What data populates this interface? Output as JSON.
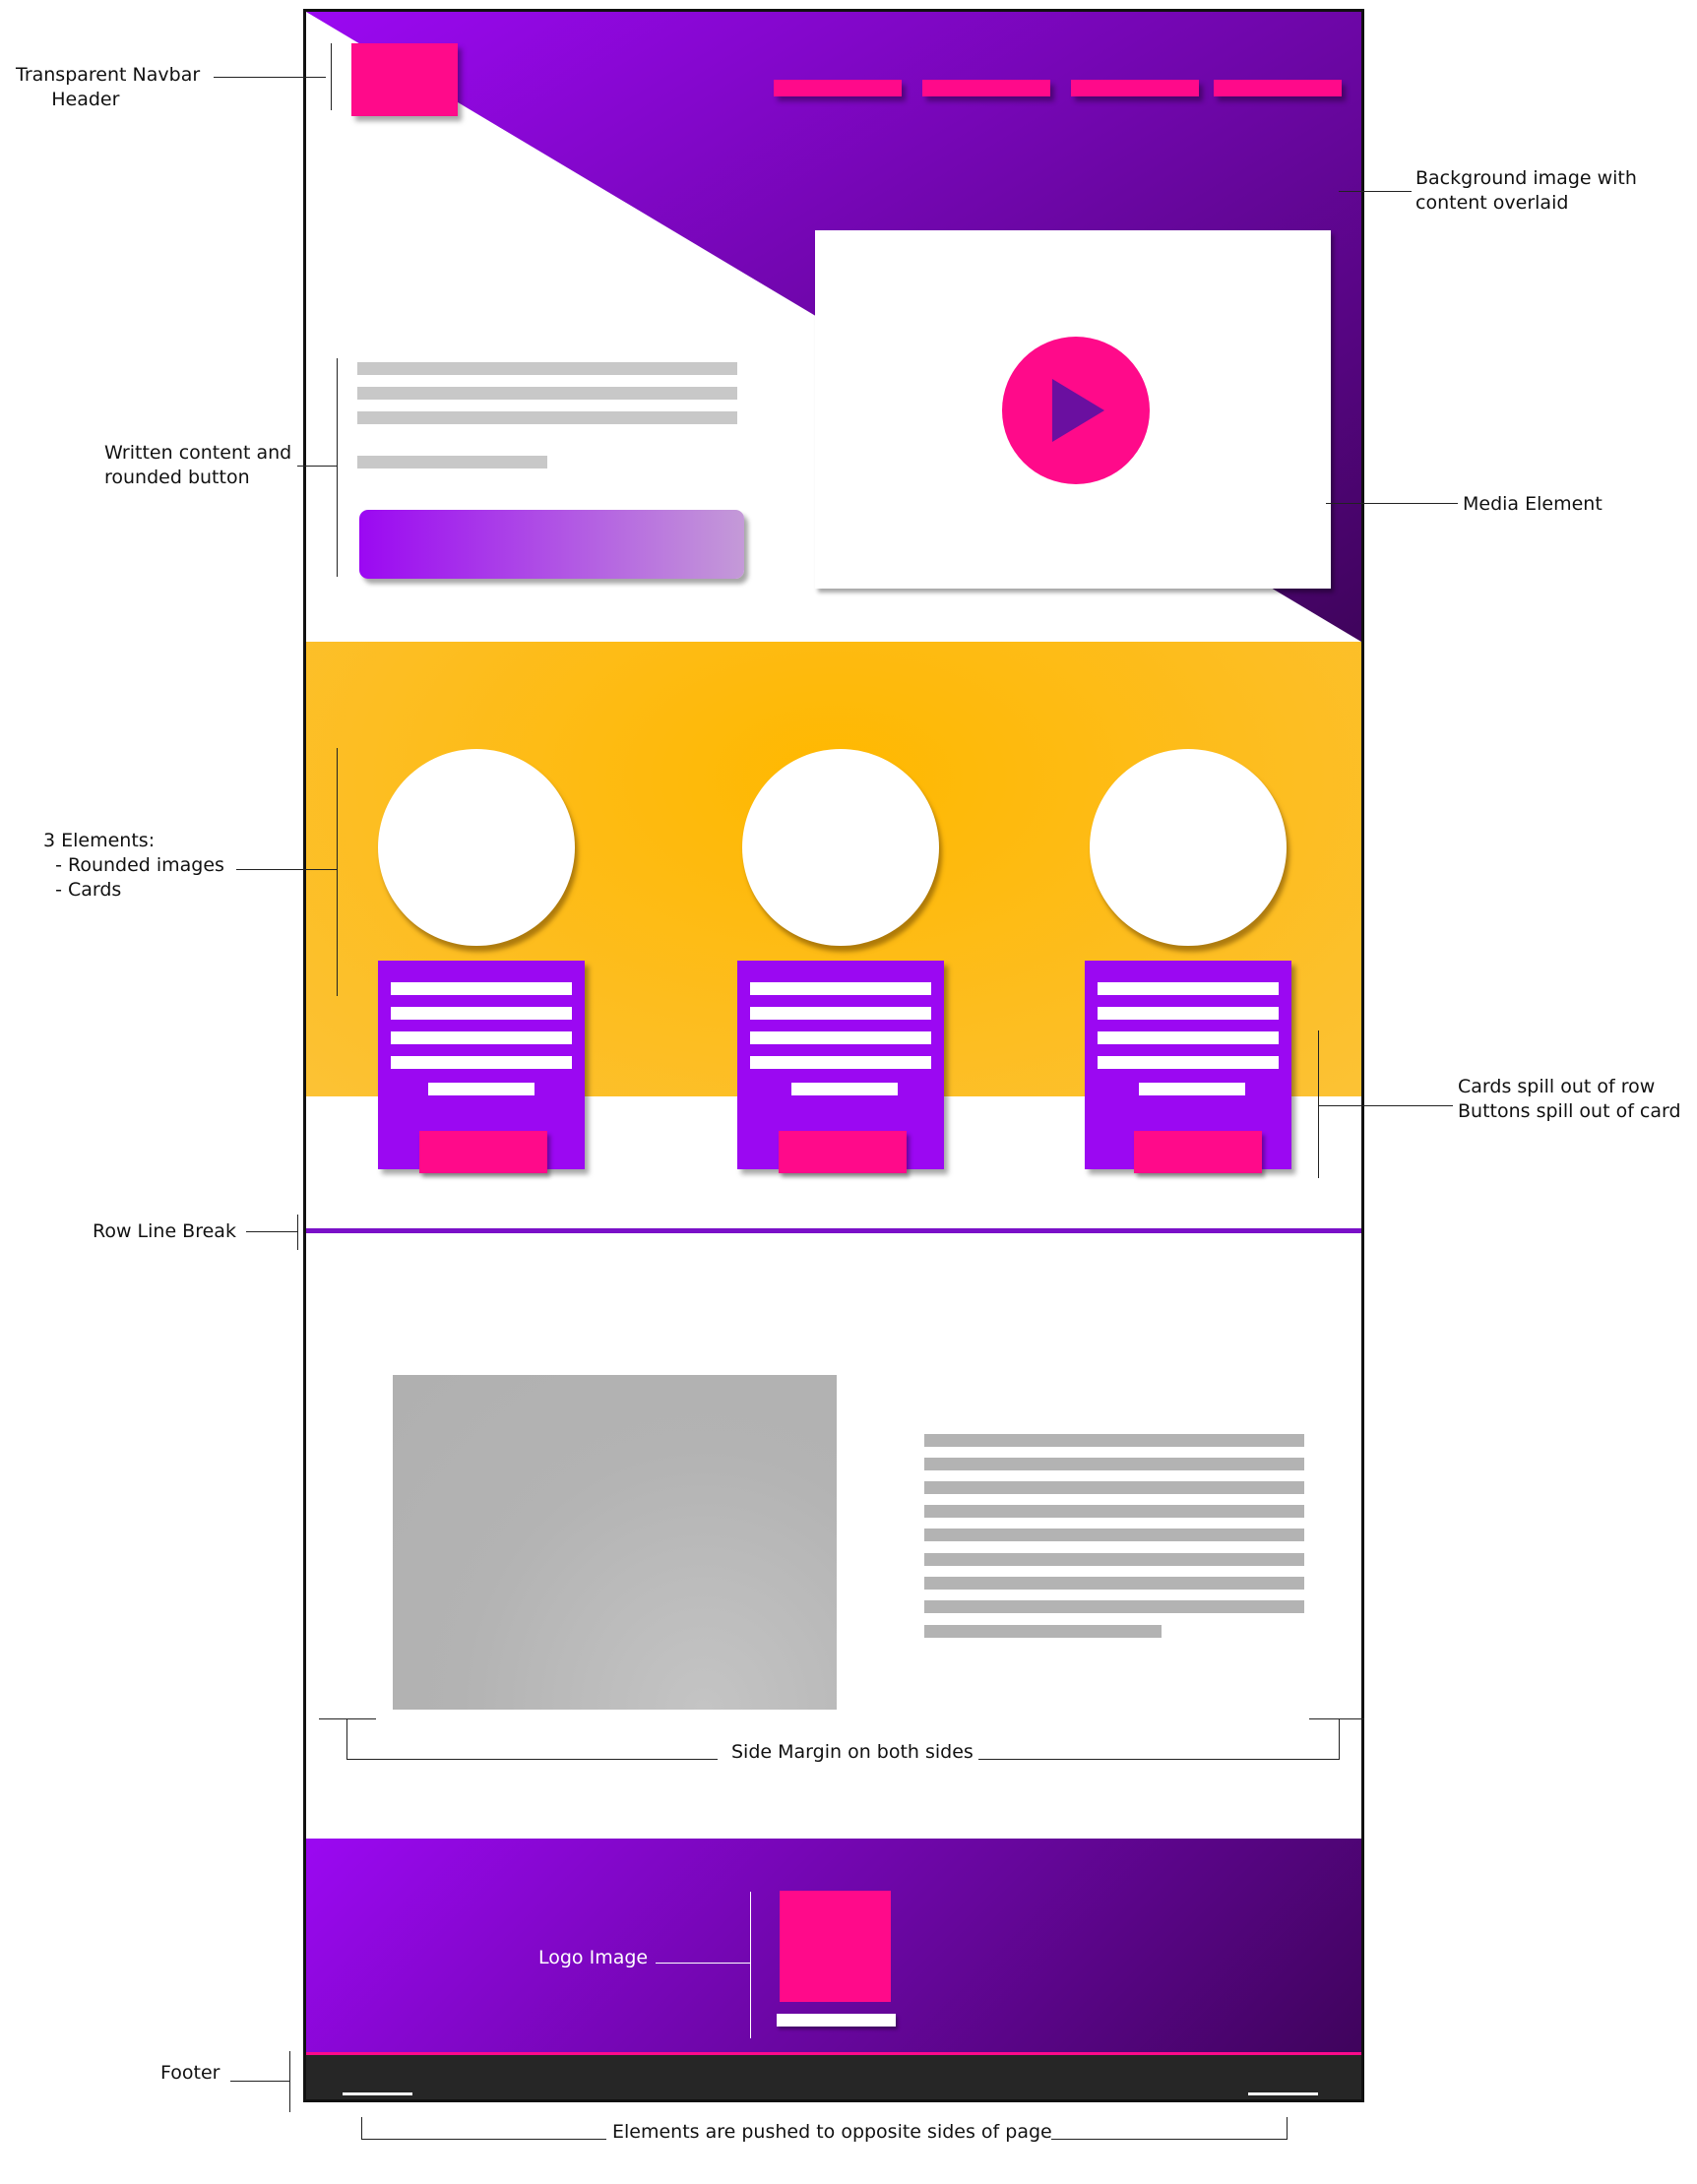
{
  "annotations": {
    "navbar": "Transparent Navbar\n      Header",
    "background": "Background image with\ncontent overlaid",
    "written": "Written content and\nrounded button",
    "media": "Media Element",
    "three": "3 Elements:\n  - Rounded images\n  - Cards",
    "spill": "Cards spill out of row\nButtons spill out of card",
    "rowbreak": "Row Line Break",
    "margin": "Side Margin on both sides",
    "logo": "Logo Image",
    "footer": "Footer",
    "opposite": "Elements are pushed to opposite sides of page"
  },
  "colors": {
    "purple_start": "#9b08f2",
    "purple_end": "#3f045c",
    "pink": "#ff0a8a",
    "yellow": "#fdbd1e",
    "footer_bar": "#262626",
    "placeholder_grey": "#b3b3b3"
  },
  "icons": {
    "media": "play-icon"
  }
}
